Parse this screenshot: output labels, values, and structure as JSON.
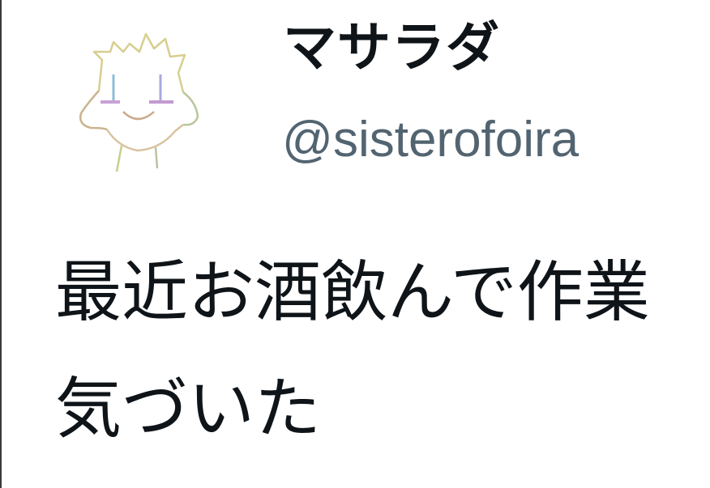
{
  "tweet": {
    "display_name": "マサラダ",
    "handle": "@sisterofoira",
    "text_lines": [
      "最近お酒飲んで作業",
      "気づいた"
    ]
  },
  "avatar": {
    "icon": "cartoon-face-avatar-icon"
  }
}
